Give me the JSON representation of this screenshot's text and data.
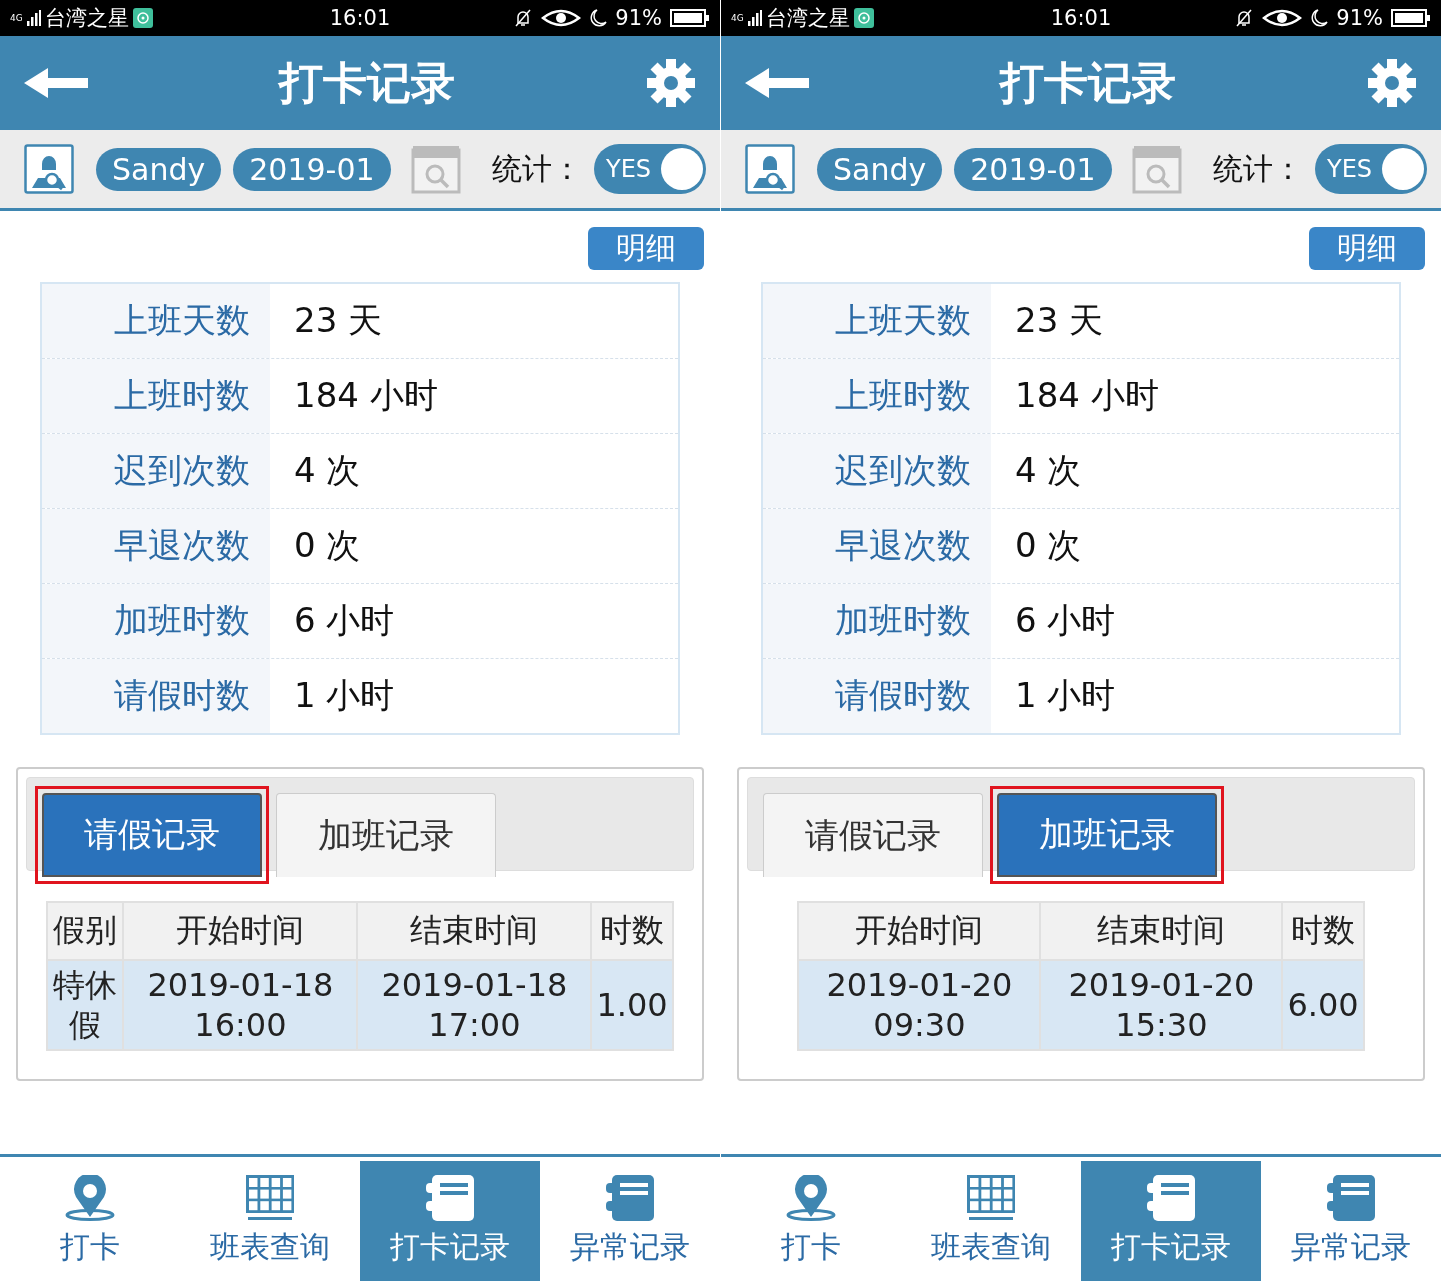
{
  "screens": [
    {
      "status_bar": {
        "network": "4G",
        "carrier": "台湾之星",
        "time": "16:01",
        "battery": "91%"
      },
      "header": {
        "title": "打卡记录"
      },
      "toolbar": {
        "user": "Sandy",
        "month": "2019-01",
        "stats_label": "统计：",
        "stats_toggle": {
          "text": "YES",
          "on": true
        }
      },
      "detail_button": "明细",
      "stats": [
        {
          "label": "上班天数",
          "value": "23 天"
        },
        {
          "label": "上班时数",
          "value": "184 小时"
        },
        {
          "label": "迟到次数",
          "value": "4 次"
        },
        {
          "label": "早退次数",
          "value": "0 次"
        },
        {
          "label": "加班时数",
          "value": "6 小时"
        },
        {
          "label": "请假时数",
          "value": "1 小时"
        }
      ],
      "tabs": [
        {
          "label": "请假记录",
          "selected": true,
          "highlighted": true
        },
        {
          "label": "加班记录",
          "selected": false,
          "highlighted": false
        }
      ],
      "table": {
        "columns": [
          "假别",
          "开始时间",
          "结束时间",
          "时数"
        ],
        "rows": [
          [
            "特休假",
            "2019-01-18 16:00",
            "2019-01-18 17:00",
            "1.00"
          ]
        ]
      },
      "bottom_nav": [
        {
          "label": "打卡",
          "kind": "pin",
          "selected": false
        },
        {
          "label": "班表查询",
          "kind": "grid",
          "selected": false
        },
        {
          "label": "打卡记录",
          "kind": "book",
          "selected": true
        },
        {
          "label": "异常记录",
          "kind": "book",
          "selected": false
        }
      ]
    },
    {
      "status_bar": {
        "network": "4G",
        "carrier": "台湾之星",
        "time": "16:01",
        "battery": "91%"
      },
      "header": {
        "title": "打卡记录"
      },
      "toolbar": {
        "user": "Sandy",
        "month": "2019-01",
        "stats_label": "统计：",
        "stats_toggle": {
          "text": "YES",
          "on": true
        }
      },
      "detail_button": "明细",
      "stats": [
        {
          "label": "上班天数",
          "value": "23 天"
        },
        {
          "label": "上班时数",
          "value": "184 小时"
        },
        {
          "label": "迟到次数",
          "value": "4 次"
        },
        {
          "label": "早退次数",
          "value": "0 次"
        },
        {
          "label": "加班时数",
          "value": "6 小时"
        },
        {
          "label": "请假时数",
          "value": "1 小时"
        }
      ],
      "tabs": [
        {
          "label": "请假记录",
          "selected": false,
          "highlighted": false
        },
        {
          "label": "加班记录",
          "selected": true,
          "highlighted": true
        }
      ],
      "table": {
        "columns": [
          "开始时间",
          "结束时间",
          "时数"
        ],
        "rows": [
          [
            "2019-01-20 09:30",
            "2019-01-20 15:30",
            "6.00"
          ]
        ]
      },
      "bottom_nav": [
        {
          "label": "打卡",
          "kind": "pin",
          "selected": false
        },
        {
          "label": "班表查询",
          "kind": "grid",
          "selected": false
        },
        {
          "label": "打卡记录",
          "kind": "book",
          "selected": true
        },
        {
          "label": "异常记录",
          "kind": "book",
          "selected": false
        }
      ]
    }
  ]
}
